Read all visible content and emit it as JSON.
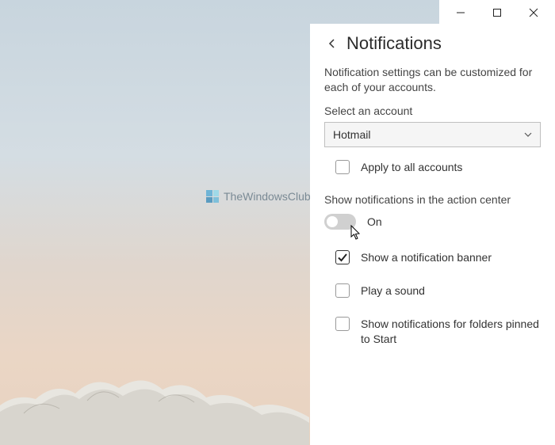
{
  "watermark": "TheWindowsClub",
  "titlebar": {
    "minimize": "minimize",
    "maximize": "maximize",
    "close": "close"
  },
  "panel": {
    "title": "Notifications",
    "description": "Notification settings can be customized for each of your accounts.",
    "select_label": "Select an account",
    "account": "Hotmail",
    "apply_all": "Apply to all accounts",
    "action_center_label": "Show notifications in the action center",
    "toggle_state": "On",
    "opt_banner": "Show a notification banner",
    "opt_sound": "Play a sound",
    "opt_folders": "Show notifications for folders pinned to Start"
  }
}
